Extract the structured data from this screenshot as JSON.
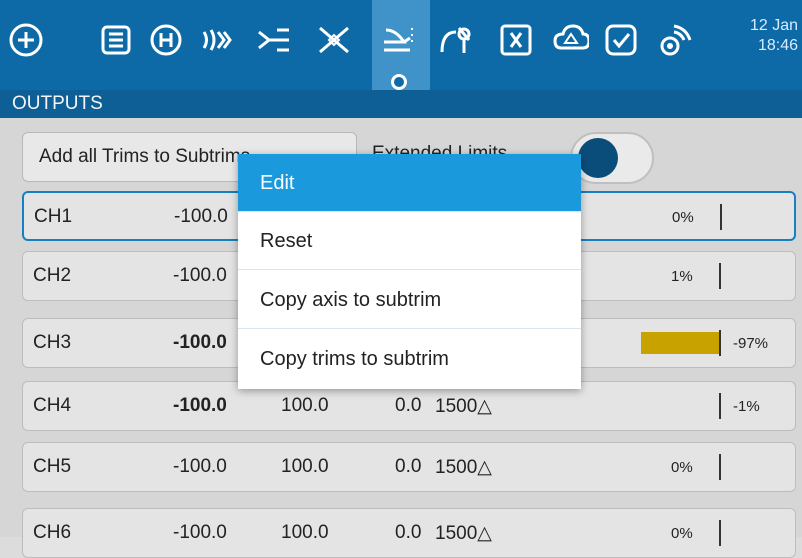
{
  "toolbar": {
    "icons": [
      "add-model-icon",
      "list-icon",
      "heli-icon",
      "flight-modes-icon",
      "mixer-icon",
      "outputs-icon",
      "curves-icon",
      "gvars-icon",
      "logical-switches-icon",
      "special-functions-icon",
      "telemetry-icon",
      "checklist-icon",
      "rf-icon"
    ],
    "active": "outputs-icon",
    "date": "12 Jan",
    "time": "18:46"
  },
  "page_title": "OUTPUTS",
  "controls": {
    "add_trims_label": "Add all Trims to Subtrims",
    "extended_limits_label": "Extended Limits",
    "extended_limits_on": true
  },
  "channels": [
    {
      "name": "CH1",
      "min": "-100.0",
      "max": "",
      "subtrim": "",
      "ppm": "",
      "percent": "0%",
      "value": "",
      "bar": 0,
      "bold": false
    },
    {
      "name": "CH2",
      "min": "-100.0",
      "max": "",
      "subtrim": "",
      "ppm": "",
      "percent": "1%",
      "value": "",
      "bar": 0,
      "bold": false
    },
    {
      "name": "CH3",
      "min": "-100.0",
      "max": "",
      "subtrim": "",
      "ppm": "",
      "percent": "",
      "value": "-97%",
      "bar": 0.97,
      "bold": true
    },
    {
      "name": "CH4",
      "min": "-100.0",
      "max": "100.0",
      "subtrim": "0.0",
      "ppm": "1500△",
      "percent": "",
      "value": "-1%",
      "bar": 0,
      "bold": true
    },
    {
      "name": "CH5",
      "min": "-100.0",
      "max": "100.0",
      "subtrim": "0.0",
      "ppm": "1500△",
      "percent": "0%",
      "value": "",
      "bar": 0,
      "bold": false
    },
    {
      "name": "CH6",
      "min": "-100.0",
      "max": "100.0",
      "subtrim": "0.0",
      "ppm": "1500△",
      "percent": "0%",
      "value": "",
      "bar": 0,
      "bold": false
    }
  ],
  "context_menu": {
    "items": [
      "Edit",
      "Reset",
      "Copy axis to subtrim",
      "Copy trims to subtrim"
    ],
    "highlighted": "Edit"
  },
  "colors": {
    "topbar": "#0d6aa6",
    "accent": "#1a99dc",
    "bar_fill": "#c8a300"
  }
}
